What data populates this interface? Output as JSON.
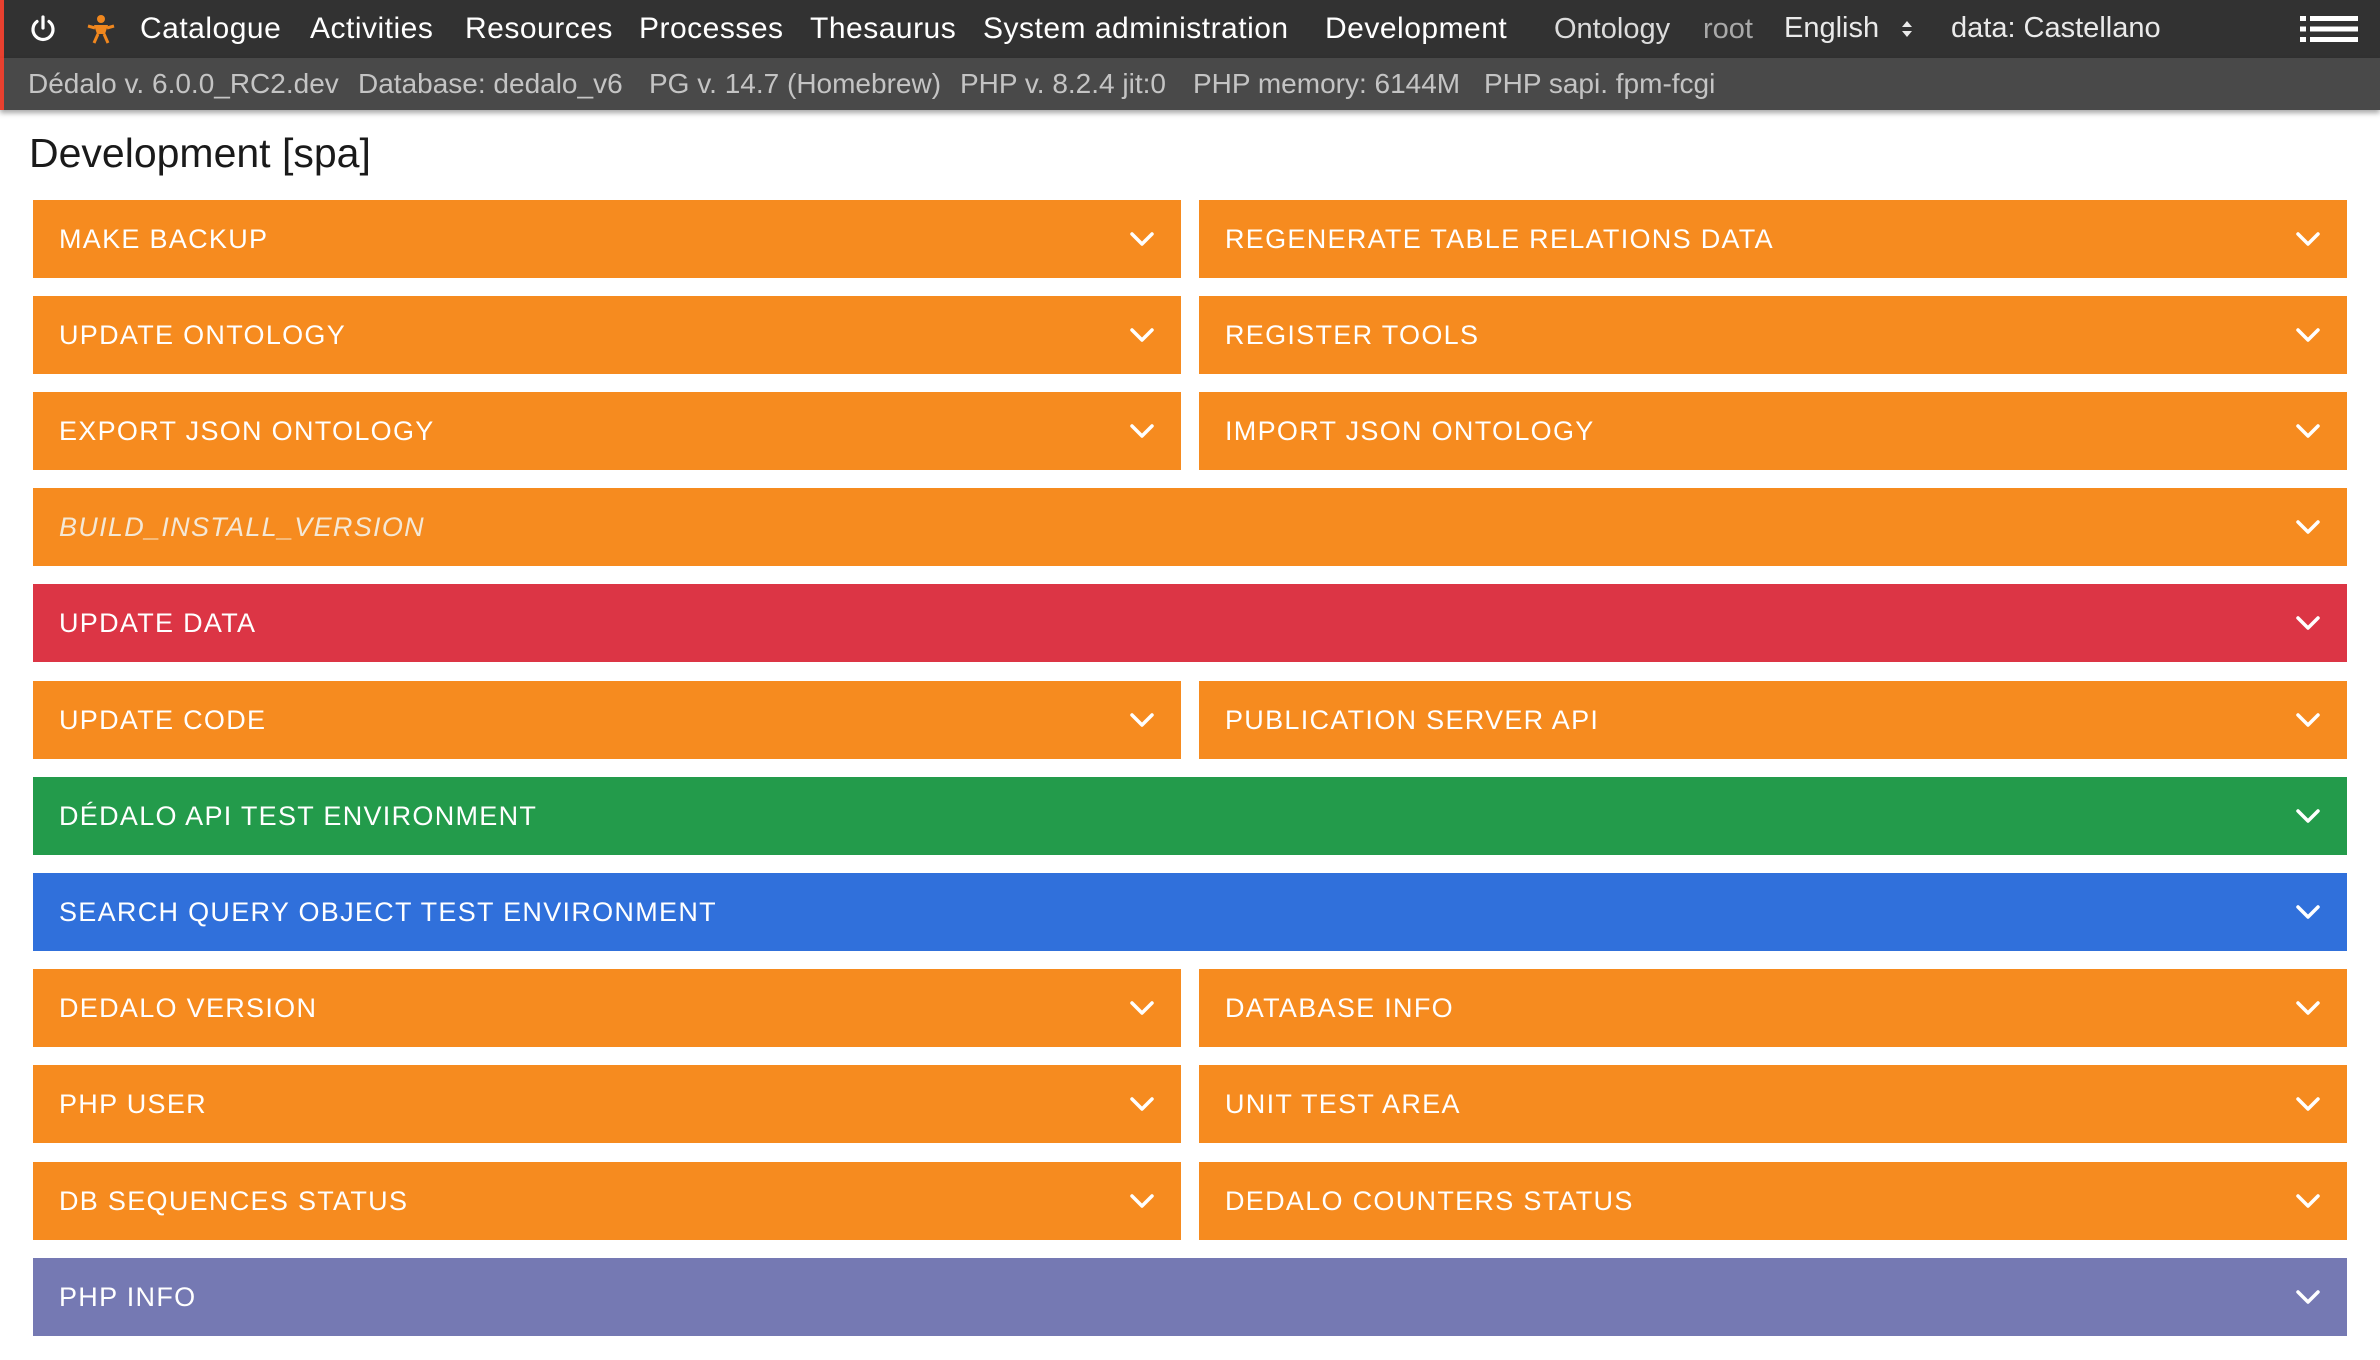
{
  "menu": {
    "items": [
      "Catalogue",
      "Activities",
      "Resources",
      "Processes",
      "Thesaurus",
      "System administration",
      "Development"
    ],
    "ontology": "Ontology",
    "user": "root",
    "language": "English",
    "data_lang": "data: Castellano",
    "colors": {
      "accent": "#e8402f",
      "logo": "#f0871e",
      "menu_bg": "#323232",
      "info_bg": "#494949"
    }
  },
  "info": {
    "version": "Dédalo v. 6.0.0_RC2.dev",
    "database": "Database: dedalo_v6",
    "pg": "PG v. 14.7 (Homebrew)",
    "php": "PHP v. 8.2.4 jit:0",
    "memory": "PHP memory: 6144M",
    "sapi": "PHP sapi. fpm-fcgi"
  },
  "page": {
    "title": "Development [spa]"
  },
  "widgets": [
    {
      "label": "MAKE BACKUP",
      "color": "#f68b1f"
    },
    {
      "label": "REGENERATE TABLE RELATIONS DATA",
      "color": "#f68b1f"
    },
    {
      "label": "UPDATE ONTOLOGY",
      "color": "#f68b1f"
    },
    {
      "label": "REGISTER TOOLS",
      "color": "#f68b1f"
    },
    {
      "label": "EXPORT JSON ONTOLOGY",
      "color": "#f68b1f"
    },
    {
      "label": "IMPORT JSON ONTOLOGY",
      "color": "#f68b1f"
    },
    {
      "label": "BUILD_INSTALL_VERSION",
      "color": "#f68b1f"
    },
    {
      "label": "UPDATE DATA",
      "color": "#dc3545"
    },
    {
      "label": "UPDATE CODE",
      "color": "#f68b1f"
    },
    {
      "label": "PUBLICATION SERVER API",
      "color": "#f68b1f"
    },
    {
      "label": "DÉDALO API TEST ENVIRONMENT",
      "color": "#239b4b"
    },
    {
      "label": "SEARCH QUERY OBJECT TEST ENVIRONMENT",
      "color": "#3070db"
    },
    {
      "label": "DEDALO VERSION",
      "color": "#f68b1f"
    },
    {
      "label": "DATABASE INFO",
      "color": "#f68b1f"
    },
    {
      "label": "PHP USER",
      "color": "#f68b1f"
    },
    {
      "label": "UNIT TEST AREA",
      "color": "#f68b1f"
    },
    {
      "label": "DB SEQUENCES STATUS",
      "color": "#f68b1f"
    },
    {
      "label": "DEDALO COUNTERS STATUS",
      "color": "#f68b1f"
    },
    {
      "label": "PHP INFO",
      "color": "#7579b3"
    }
  ],
  "icons": {
    "power": "power-icon",
    "logo": "dedalo-logo-icon",
    "language_select": "select-arrows-icon",
    "menu_toggle": "list-menu-icon",
    "expand": "chevron-down-icon"
  }
}
